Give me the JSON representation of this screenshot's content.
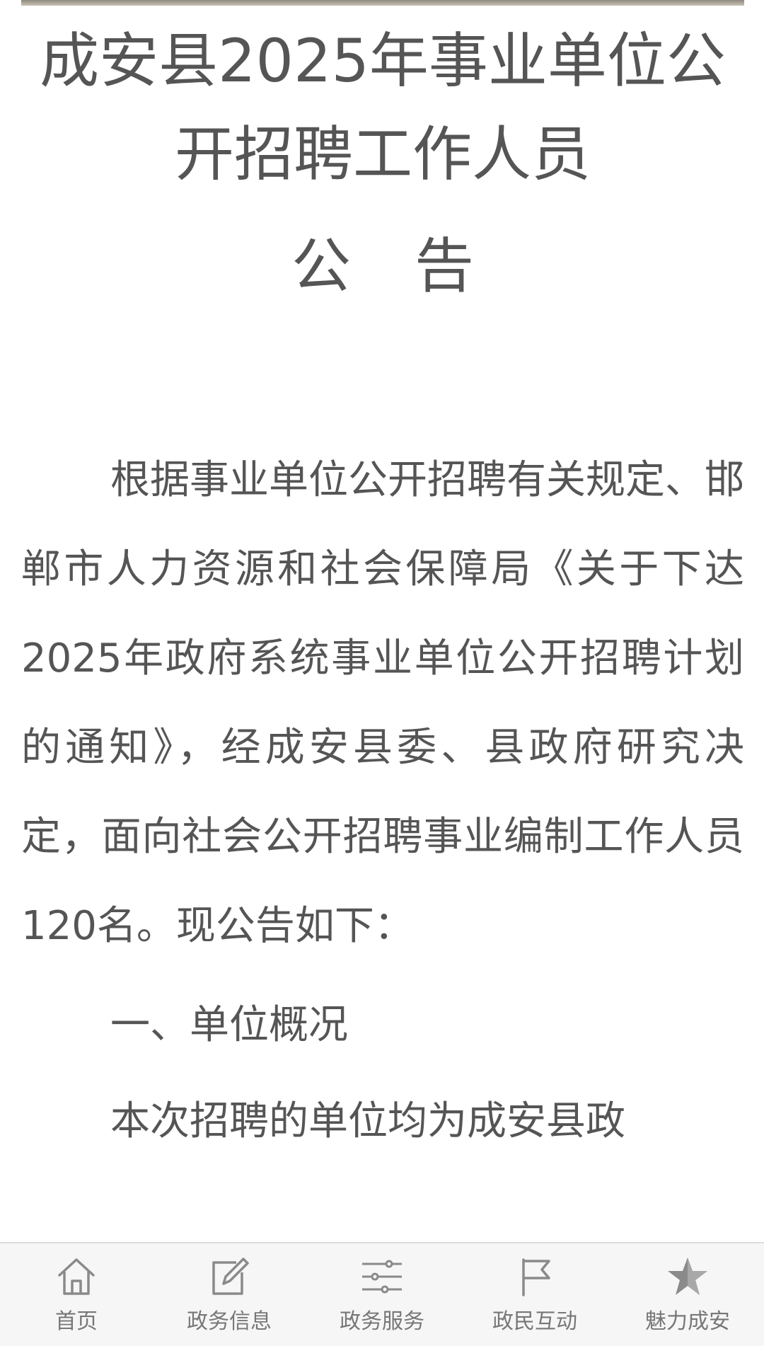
{
  "article": {
    "title": "成安县2025年事业单位公开招聘工作人员",
    "heading": "公告",
    "intro": "根据事业单位公开招聘有关规定、邯郸市人力资源和社会保障局《关于下达2025年政府系统事业单位公开招聘计划的通知》，经成安县委、县政府研究决定，面向社会公开招聘事业编制工作人员120名。现公告如下：",
    "section_1": "一、单位概况",
    "section_1_text": "本次招聘的单位均为成安县政"
  },
  "bottom_nav": {
    "items": [
      {
        "label": "首页",
        "icon": "home-icon"
      },
      {
        "label": "政务信息",
        "icon": "edit-icon"
      },
      {
        "label": "政务服务",
        "icon": "sliders-icon"
      },
      {
        "label": "政民互动",
        "icon": "flag-icon"
      },
      {
        "label": "魅力成安",
        "icon": "star-icon"
      }
    ]
  },
  "colors": {
    "text": "#555555",
    "nav_background": "#f6f6f6",
    "nav_label": "#777777",
    "icon": "#8a8a8a"
  }
}
